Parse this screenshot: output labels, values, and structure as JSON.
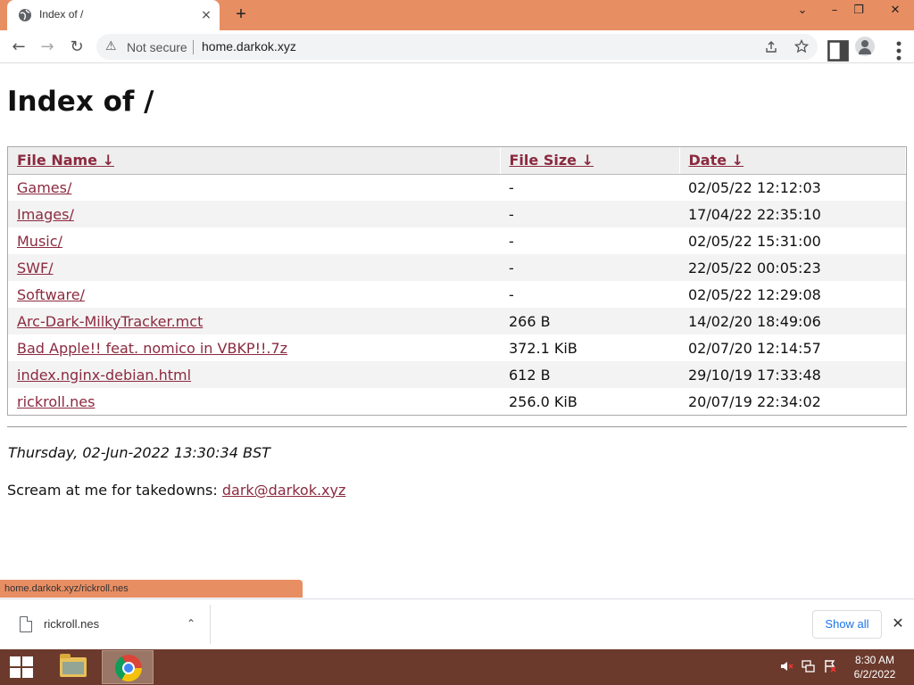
{
  "browser": {
    "tab": {
      "title": "Index of /",
      "close_icon": "×"
    },
    "new_tab_icon": "+",
    "window_controls": {
      "dropdown": "⌄",
      "minimize": "–",
      "restore": "❐",
      "close": "✕"
    },
    "toolbar": {
      "back": "←",
      "forward": "→",
      "reload": "↻",
      "security_icon": "⚠",
      "security_label": "Not secure",
      "url": "home.darkok.xyz"
    }
  },
  "page": {
    "title": "Index of /",
    "columns": [
      {
        "label": "File Name",
        "sort": "↓"
      },
      {
        "label": "File Size",
        "sort": "↓"
      },
      {
        "label": "Date",
        "sort": "↓"
      }
    ],
    "rows": [
      {
        "name": "Games/",
        "size": "-",
        "date": "02/05/22 12:12:03"
      },
      {
        "name": "Images/",
        "size": "-",
        "date": "17/04/22 22:35:10"
      },
      {
        "name": "Music/",
        "size": "-",
        "date": "02/05/22 15:31:00"
      },
      {
        "name": "SWF/",
        "size": "-",
        "date": "22/05/22 00:05:23"
      },
      {
        "name": "Software/",
        "size": "-",
        "date": "02/05/22 12:29:08"
      },
      {
        "name": "Arc-Dark-MilkyTracker.mct",
        "size": "266 B",
        "date": "14/02/20 18:49:06"
      },
      {
        "name": "Bad Apple!! feat. nomico in VBKP!!.7z",
        "size": "372.1 KiB",
        "date": "02/07/20 12:14:57"
      },
      {
        "name": "index.nginx-debian.html",
        "size": "612 B",
        "date": "29/10/19 17:33:48"
      },
      {
        "name": "rickroll.nes",
        "size": "256.0 KiB",
        "date": "20/07/19 22:34:02"
      }
    ],
    "timestamp": "Thursday, 02-Jun-2022 13:30:34 BST",
    "contact_prefix": "Scream at me for takedowns: ",
    "contact_email": "dark@darkok.xyz"
  },
  "status_bubble": "home.darkok.xyz/rickroll.nes",
  "download_shelf": {
    "file_name": "rickroll.nes",
    "chevron": "⌃",
    "show_all": "Show all",
    "close": "✕"
  },
  "taskbar": {
    "time": "8:30 AM",
    "date": "6/2/2022"
  },
  "colors": {
    "accent": "#e88e63",
    "link": "#8b2a3f",
    "taskbar": "#6b3a2c"
  }
}
